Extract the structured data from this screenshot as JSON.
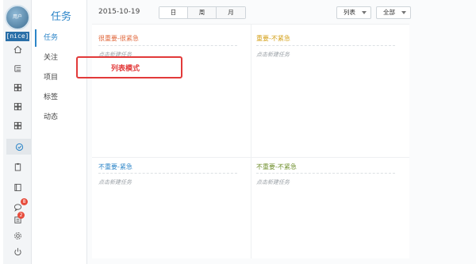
{
  "user": {
    "avatar_text": "用户",
    "name": "[nice]"
  },
  "nav": {
    "title": "任务",
    "items": [
      {
        "label": "任务"
      },
      {
        "label": "关注"
      },
      {
        "label": "项目"
      },
      {
        "label": "标签"
      },
      {
        "label": "动态"
      }
    ]
  },
  "toolbar": {
    "date": "2015-10-19",
    "views": [
      "日",
      "周",
      "月"
    ],
    "mode_select": "列表",
    "filter_select": "全部"
  },
  "quadrants": [
    {
      "title": "很重要-很紧急",
      "new_task": "点击新建任务",
      "color": "#e0663a"
    },
    {
      "title": "重要-不紧急",
      "new_task": "点击新建任务",
      "color": "#d4a017"
    },
    {
      "title": "不重要-紧急",
      "new_task": "点击新建任务",
      "color": "#2c85c8"
    },
    {
      "title": "不重要-不紧急",
      "new_task": "点击新建任务",
      "color": "#6f8f2c"
    }
  ],
  "annotation": {
    "label": "列表模式"
  },
  "badges": {
    "chat": "8",
    "tasks": "2"
  },
  "colors": {
    "accent": "#2c85c8",
    "annotation": "#e23a3a"
  }
}
